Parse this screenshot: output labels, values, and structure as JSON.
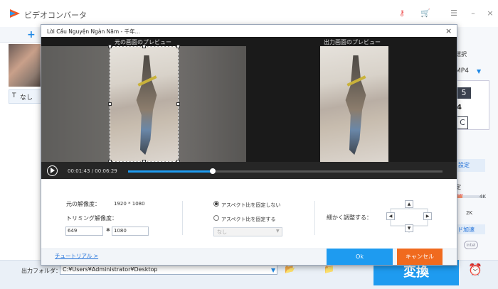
{
  "app": {
    "title": "ビデオコンバータ",
    "toolbar_add": "+ ",
    "subtitle_label": "なし",
    "subtitle_icon": "T",
    "right_panel": {
      "select_label": "選択",
      "format": "MP4",
      "format_arrow": "▼",
      "format_icon_a": "5",
      "format_icon_b": "4",
      "format_icon_c": "C",
      "settings": "設定",
      "quality_label": "定",
      "quality_low": "0P",
      "quality_high": "4K",
      "quality_value": "2K",
      "hw_accel": "ド加速",
      "intel": "intel"
    },
    "output_folder_label": "出力フォルダ：",
    "output_path": "C:¥Users¥Administrator¥Desktop",
    "output_dropdown": "▼",
    "convert_button": "変換"
  },
  "dialog": {
    "title": "Lời Cầu Nguyện Ngàn Năm - 千年...",
    "close": "×",
    "source_preview_label": "元の画面のプレビュー",
    "output_preview_label": "出力画面のプレビュー",
    "current_time": "00:01:43",
    "time_separator": "/",
    "total_time": "00:06:29",
    "progress": 0.27,
    "original_resolution_label": "元の解像度：",
    "original_resolution_value": "1920 * 1080",
    "trim_resolution_label": "トリミング解像度：",
    "trim_width": "649",
    "trim_x": "✱",
    "trim_height": "1080",
    "aspect_unlocked": "アスペクト比を固定しない",
    "aspect_locked": "アスペクト比を固定する",
    "aspect_option": "なし",
    "fine_adjust_label": "細かく調整する：",
    "tutorial_link": "チュートリアル >",
    "ok_button": "Ok",
    "cancel_button": "キャンセル"
  },
  "colors": {
    "accent": "#1e9bf0",
    "cancel": "#f06a1e",
    "link": "#1e6fd9"
  }
}
